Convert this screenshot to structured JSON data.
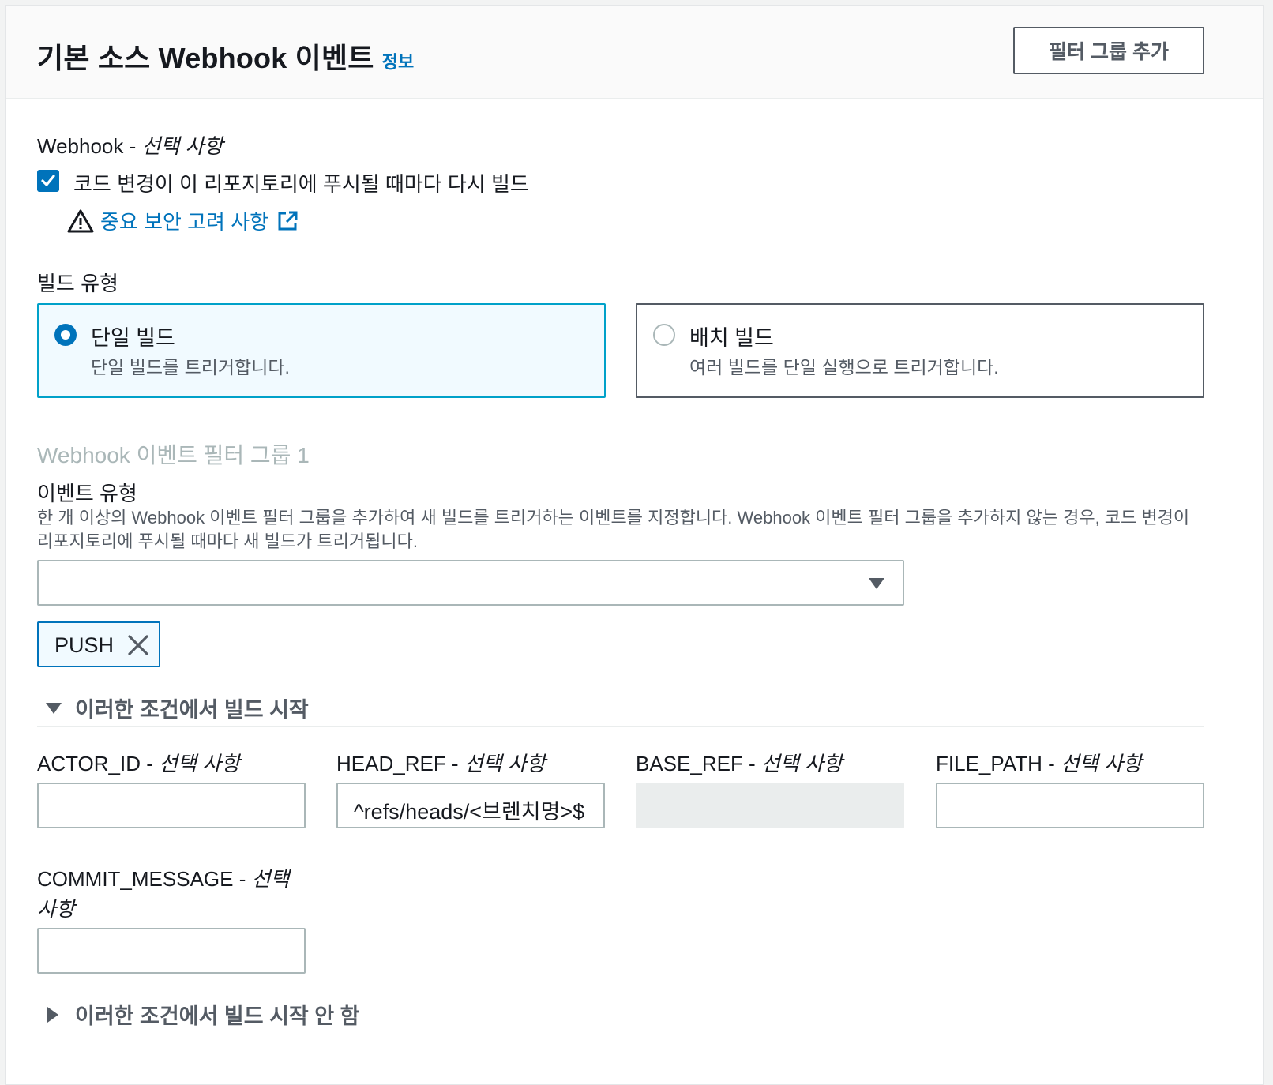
{
  "header": {
    "title": "기본 소스 Webhook 이벤트",
    "info_link": "정보",
    "add_filter_group_button": "필터 그룹 추가"
  },
  "webhook": {
    "label": "Webhook - ",
    "label_optional": "선택 사항",
    "checkbox_label": "코드 변경이 이 리포지토리에 푸시될 때마다 다시 빌드",
    "checkbox_checked": true,
    "security_link": "중요 보안 고려 사항"
  },
  "build_type": {
    "label": "빌드 유형",
    "options": [
      {
        "title": "단일 빌드",
        "description": "단일 빌드를 트리거합니다.",
        "selected": true
      },
      {
        "title": "배치 빌드",
        "description": "여러 빌드를 단일 실행으로 트리거합니다.",
        "selected": false
      }
    ]
  },
  "filter_group": {
    "heading": "Webhook 이벤트 필터 그룹 1",
    "event_type_label": "이벤트 유형",
    "event_type_description_line1": "한 개 이상의 Webhook 이벤트 필터 그룹을 추가하여 새 빌드를 트리거하는 이벤트를 지정합니다. Webhook 이벤트 필터 그룹을 추가하지 않는 경우, 코드 변경이",
    "event_type_description_line2": "리포지토리에 푸시될 때마다 새 빌드가 트리거됩니다.",
    "select_value": "",
    "selected_tokens": [
      "PUSH"
    ],
    "start_conditions_label": "이러한 조건에서 빌드 시작",
    "start_conditions_expanded": true,
    "fields": [
      {
        "name": "ACTOR_ID",
        "optional": "선택 사항",
        "value": "",
        "disabled": false
      },
      {
        "name": "HEAD_REF",
        "optional": "선택 사항",
        "value": "^refs/heads/<브렌치명>$",
        "disabled": false
      },
      {
        "name": "BASE_REF",
        "optional": "선택 사항",
        "value": "",
        "disabled": true
      },
      {
        "name": "FILE_PATH",
        "optional": "선택 사항",
        "value": "",
        "disabled": false
      }
    ],
    "commit_message": {
      "name": "COMMIT_MESSAGE",
      "optional_line1": "선택",
      "optional_line2": "사항",
      "value": ""
    },
    "do_not_start_label": "이러한 조건에서 빌드 시작 안 함",
    "do_not_start_expanded": false
  },
  "colors": {
    "accent": "#0073bb",
    "selected_border": "#00a1c9",
    "text": "#16191f",
    "muted": "#545b64"
  }
}
